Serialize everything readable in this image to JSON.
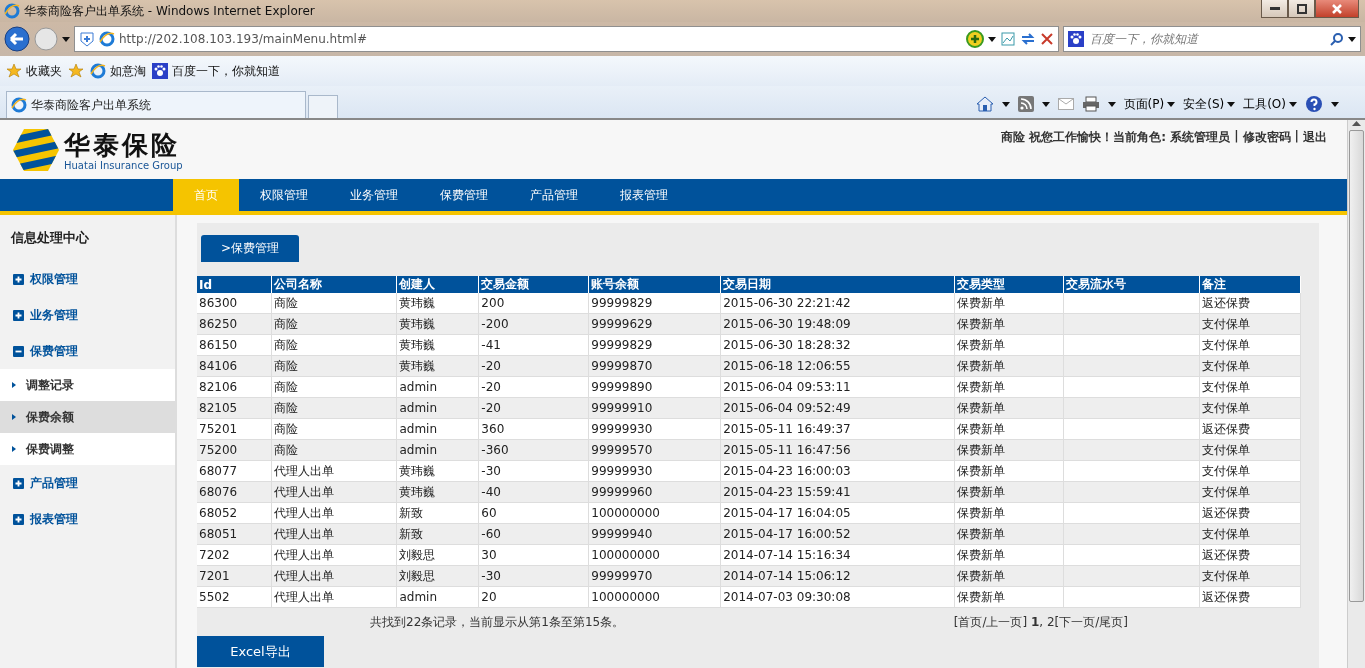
{
  "browser": {
    "title": "华泰商险客户出单系统 - Windows Internet Explorer",
    "address": "http://202.108.103.193/mainMenu.html#",
    "search_placeholder": "百度一下，你就知道",
    "favorites": [
      "收藏夹",
      "如意淘",
      "百度一下，你就知道"
    ],
    "tabs": [
      {
        "label": "华泰商险客户出单系统",
        "selected": true
      }
    ],
    "commands": [
      "页面(P)",
      "安全(S)",
      "工具(O)"
    ]
  },
  "header": {
    "logo_text": "华泰保险",
    "logo_subtitle": "Huatai Insurance Group",
    "user_info": "商险 祝您工作愉快！当前角色: 系统管理员",
    "separator": "|",
    "links": [
      "修改密码",
      "退出"
    ]
  },
  "nav": [
    {
      "label": "首页",
      "selected": true
    },
    {
      "label": "权限管理",
      "selected": false
    },
    {
      "label": "业务管理",
      "selected": false
    },
    {
      "label": "保费管理",
      "selected": false
    },
    {
      "label": "产品管理",
      "selected": false
    },
    {
      "label": "报表管理",
      "selected": false
    }
  ],
  "sidebar": {
    "title": "信息处理中心",
    "groups": [
      {
        "label": "权限管理",
        "expanded": false
      },
      {
        "label": "业务管理",
        "expanded": false
      },
      {
        "label": "保费管理",
        "expanded": true,
        "children": [
          {
            "label": "调整记录",
            "selected": false
          },
          {
            "label": "保费余额",
            "selected": true
          },
          {
            "label": "保费调整",
            "selected": false
          }
        ]
      },
      {
        "label": "产品管理",
        "expanded": false
      },
      {
        "label": "报表管理",
        "expanded": false
      }
    ]
  },
  "breadcrumb": ">保费管理",
  "table": {
    "columns": [
      "Id",
      "公司名称",
      "创建人",
      "交易金额",
      "账号余额",
      "交易日期",
      "交易类型",
      "交易流水号",
      "备注"
    ],
    "rows": [
      [
        "86300",
        "商险",
        "黄玮巍",
        "200",
        "99999829",
        "2015-06-30 22:21:42",
        "保费新单",
        null,
        "返还保费"
      ],
      [
        "86250",
        "商险",
        "黄玮巍",
        "-200",
        "99999629",
        "2015-06-30 19:48:09",
        "保费新单",
        null,
        "支付保单"
      ],
      [
        "86150",
        "商险",
        "黄玮巍",
        "-41",
        "99999829",
        "2015-06-30 18:28:32",
        "保费新单",
        null,
        "支付保单"
      ],
      [
        "84106",
        "商险",
        "黄玮巍",
        "-20",
        "99999870",
        "2015-06-18 12:06:55",
        "保费新单",
        null,
        "支付保单"
      ],
      [
        "82106",
        "商险",
        "admin",
        "-20",
        "99999890",
        "2015-06-04 09:53:11",
        "保费新单",
        null,
        "支付保单"
      ],
      [
        "82105",
        "商险",
        "admin",
        "-20",
        "99999910",
        "2015-06-04 09:52:49",
        "保费新单",
        null,
        "支付保单"
      ],
      [
        "75201",
        "商险",
        "admin",
        "360",
        "99999930",
        "2015-05-11 16:49:37",
        "保费新单",
        null,
        "返还保费"
      ],
      [
        "75200",
        "商险",
        "admin",
        "-360",
        "99999570",
        "2015-05-11 16:47:56",
        "保费新单",
        null,
        "支付保单"
      ],
      [
        "68077",
        "代理人出单",
        "黄玮巍",
        "-30",
        "99999930",
        "2015-04-23 16:00:03",
        "保费新单",
        null,
        "支付保单"
      ],
      [
        "68076",
        "代理人出单",
        "黄玮巍",
        "-40",
        "99999960",
        "2015-04-23 15:59:41",
        "保费新单",
        null,
        "支付保单"
      ],
      [
        "68052",
        "代理人出单",
        "新致",
        "60",
        "100000000",
        "2015-04-17 16:04:05",
        "保费新单",
        null,
        "返还保费"
      ],
      [
        "68051",
        "代理人出单",
        "新致",
        "-60",
        "99999940",
        "2015-04-17 16:00:52",
        "保费新单",
        null,
        "支付保单"
      ],
      [
        "7202",
        "代理人出单",
        "刘毅思",
        "30",
        "100000000",
        "2014-07-14 15:16:34",
        "保费新单",
        null,
        "返还保费"
      ],
      [
        "7201",
        "代理人出单",
        "刘毅思",
        "-30",
        "99999970",
        "2014-07-14 15:06:12",
        "保费新单",
        null,
        "支付保单"
      ],
      [
        "5502",
        "代理人出单",
        "admin",
        "20",
        "100000000",
        "2014-07-03 09:30:08",
        "保费新单",
        null,
        "返还保费"
      ]
    ]
  },
  "summary": "共找到22条记录，当前显示从第1条至第15条。",
  "pagination": "[首页/上一页] **1**, 2[下一页/尾页]",
  "export_button": "Excel导出"
}
